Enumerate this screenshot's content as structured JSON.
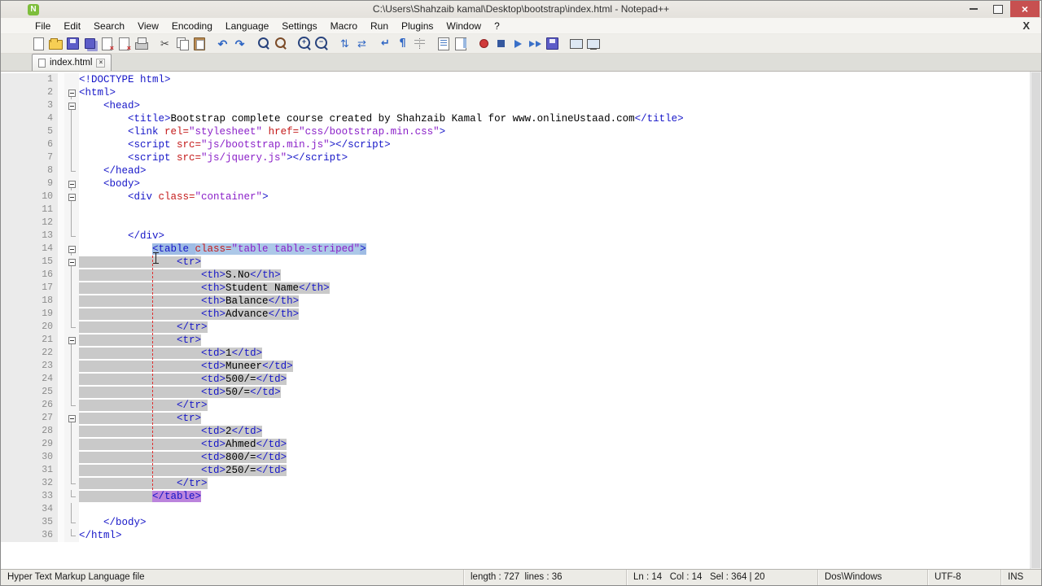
{
  "window": {
    "title": "C:\\Users\\Shahzaib kamal\\Desktop\\bootstrap\\index.html - Notepad++"
  },
  "menu": {
    "items": [
      "File",
      "Edit",
      "Search",
      "View",
      "Encoding",
      "Language",
      "Settings",
      "Macro",
      "Run",
      "Plugins",
      "Window",
      "?"
    ],
    "right_x": "X"
  },
  "toolbar": {
    "icons": [
      "new-file",
      "open-folder",
      "save",
      "save-all",
      "close-doc",
      "close-all",
      "print",
      "|",
      "cut",
      "copy",
      "paste",
      "|",
      "undo",
      "redo",
      "|",
      "find",
      "replace",
      "|",
      "zoom-in",
      "zoom-out",
      "|",
      "sync-v",
      "sync-h",
      "|",
      "word-wrap",
      "show-all-chars",
      "indent-guide",
      "|",
      "function-list",
      "doc-map",
      "|",
      "record-macro",
      "stop-macro",
      "play-macro",
      "run-macro-multi",
      "save-macro",
      "|",
      "fullscreen",
      "doc-monitor"
    ]
  },
  "tabs": [
    {
      "label": "index.html"
    }
  ],
  "editor": {
    "lines": [
      {
        "n": 1,
        "f": "",
        "s": "",
        "g": [
          [
            "doc",
            "<!DOCTYPE html>"
          ]
        ]
      },
      {
        "n": 2,
        "f": "b",
        "s": "",
        "g": [
          [
            "tag",
            "<html>"
          ]
        ]
      },
      {
        "n": 3,
        "f": "b",
        "s": "",
        "g": [
          [
            "w",
            "    "
          ],
          [
            "tag",
            "<head>"
          ]
        ]
      },
      {
        "n": 4,
        "f": "v",
        "s": "",
        "g": [
          [
            "w",
            "        "
          ],
          [
            "tag",
            "<title>"
          ],
          [
            "txt",
            "Bootstrap complete course created by Shahzaib Kamal for www.onlineUstaad.com"
          ],
          [
            "tag",
            "</title>"
          ]
        ]
      },
      {
        "n": 5,
        "f": "v",
        "s": "",
        "g": [
          [
            "w",
            "        "
          ],
          [
            "tag",
            "<link "
          ],
          [
            "attr",
            "rel="
          ],
          [
            "val",
            "\"stylesheet\""
          ],
          [
            "w",
            " "
          ],
          [
            "attr",
            "href="
          ],
          [
            "val",
            "\"css/bootstrap.min.css\""
          ],
          [
            "tag",
            ">"
          ]
        ]
      },
      {
        "n": 6,
        "f": "v",
        "s": "",
        "g": [
          [
            "w",
            "        "
          ],
          [
            "tag",
            "<script "
          ],
          [
            "attr",
            "src="
          ],
          [
            "val",
            "\"js/bootstrap.min.js\""
          ],
          [
            "tag",
            "></script>"
          ]
        ]
      },
      {
        "n": 7,
        "f": "v",
        "s": "",
        "g": [
          [
            "w",
            "        "
          ],
          [
            "tag",
            "<script "
          ],
          [
            "attr",
            "src="
          ],
          [
            "val",
            "\"js/jquery.js\""
          ],
          [
            "tag",
            "></script>"
          ]
        ]
      },
      {
        "n": 8,
        "f": "l",
        "s": "",
        "g": [
          [
            "w",
            "    "
          ],
          [
            "tag",
            "</head>"
          ]
        ]
      },
      {
        "n": 9,
        "f": "b",
        "s": "",
        "g": [
          [
            "w",
            "    "
          ],
          [
            "tag",
            "<body>"
          ]
        ]
      },
      {
        "n": 10,
        "f": "b",
        "s": "",
        "g": [
          [
            "w",
            "        "
          ],
          [
            "tag",
            "<div "
          ],
          [
            "attr",
            "class="
          ],
          [
            "val",
            "\"container\""
          ],
          [
            "tag",
            ">"
          ]
        ]
      },
      {
        "n": 11,
        "f": "v",
        "s": "",
        "g": []
      },
      {
        "n": 12,
        "f": "v",
        "s": "",
        "g": []
      },
      {
        "n": 13,
        "f": "l",
        "s": "",
        "g": [
          [
            "w",
            "        "
          ],
          [
            "tag",
            "</div>"
          ]
        ]
      },
      {
        "n": 14,
        "f": "b",
        "s": "blue",
        "g": [
          [
            "w",
            "            "
          ],
          [
            "tagh",
            "<table "
          ],
          [
            "attr",
            "class="
          ],
          [
            "val",
            "\"table table-striped\""
          ],
          [
            "tagh",
            ">"
          ]
        ]
      },
      {
        "n": 15,
        "f": "b",
        "s": "gray",
        "g": [
          [
            "w",
            "                "
          ],
          [
            "tag",
            "<tr>"
          ]
        ]
      },
      {
        "n": 16,
        "f": "v",
        "s": "gray",
        "g": [
          [
            "w",
            "                    "
          ],
          [
            "tag",
            "<th>"
          ],
          [
            "txt",
            "S.No"
          ],
          [
            "tag",
            "</th>"
          ]
        ]
      },
      {
        "n": 17,
        "f": "v",
        "s": "gray",
        "g": [
          [
            "w",
            "                    "
          ],
          [
            "tag",
            "<th>"
          ],
          [
            "txt",
            "Student Name"
          ],
          [
            "tag",
            "</th>"
          ]
        ]
      },
      {
        "n": 18,
        "f": "v",
        "s": "gray",
        "g": [
          [
            "w",
            "                    "
          ],
          [
            "tag",
            "<th>"
          ],
          [
            "txt",
            "Balance"
          ],
          [
            "tag",
            "</th>"
          ]
        ]
      },
      {
        "n": 19,
        "f": "v",
        "s": "gray",
        "g": [
          [
            "w",
            "                    "
          ],
          [
            "tag",
            "<th>"
          ],
          [
            "txt",
            "Advance"
          ],
          [
            "tag",
            "</th>"
          ]
        ]
      },
      {
        "n": 20,
        "f": "l",
        "s": "gray",
        "g": [
          [
            "w",
            "                "
          ],
          [
            "tag",
            "</tr>"
          ]
        ]
      },
      {
        "n": 21,
        "f": "b",
        "s": "gray",
        "g": [
          [
            "w",
            "                "
          ],
          [
            "tag",
            "<tr>"
          ]
        ]
      },
      {
        "n": 22,
        "f": "v",
        "s": "gray",
        "g": [
          [
            "w",
            "                    "
          ],
          [
            "tag",
            "<td>"
          ],
          [
            "txt",
            "1"
          ],
          [
            "tag",
            "</td>"
          ]
        ]
      },
      {
        "n": 23,
        "f": "v",
        "s": "gray",
        "g": [
          [
            "w",
            "                    "
          ],
          [
            "tag",
            "<td>"
          ],
          [
            "txt",
            "Muneer"
          ],
          [
            "tag",
            "</td>"
          ]
        ]
      },
      {
        "n": 24,
        "f": "v",
        "s": "gray",
        "g": [
          [
            "w",
            "                    "
          ],
          [
            "tag",
            "<td>"
          ],
          [
            "txt",
            "500/="
          ],
          [
            "tag",
            "</td>"
          ]
        ]
      },
      {
        "n": 25,
        "f": "v",
        "s": "gray",
        "g": [
          [
            "w",
            "                    "
          ],
          [
            "tag",
            "<td>"
          ],
          [
            "txt",
            "50/="
          ],
          [
            "tag",
            "</td>"
          ]
        ]
      },
      {
        "n": 26,
        "f": "l",
        "s": "gray",
        "g": [
          [
            "w",
            "                "
          ],
          [
            "tag",
            "</tr>"
          ]
        ]
      },
      {
        "n": 27,
        "f": "b",
        "s": "gray",
        "g": [
          [
            "w",
            "                "
          ],
          [
            "tag",
            "<tr>"
          ]
        ]
      },
      {
        "n": 28,
        "f": "v",
        "s": "gray",
        "g": [
          [
            "w",
            "                    "
          ],
          [
            "tag",
            "<td>"
          ],
          [
            "txt",
            "2"
          ],
          [
            "tag",
            "</td>"
          ]
        ]
      },
      {
        "n": 29,
        "f": "v",
        "s": "gray",
        "g": [
          [
            "w",
            "                    "
          ],
          [
            "tag",
            "<td>"
          ],
          [
            "txt",
            "Ahmed"
          ],
          [
            "tag",
            "</td>"
          ]
        ]
      },
      {
        "n": 30,
        "f": "v",
        "s": "gray",
        "g": [
          [
            "w",
            "                    "
          ],
          [
            "tag",
            "<td>"
          ],
          [
            "txt",
            "800/="
          ],
          [
            "tag",
            "</td>"
          ]
        ]
      },
      {
        "n": 31,
        "f": "v",
        "s": "gray",
        "g": [
          [
            "w",
            "                    "
          ],
          [
            "tag",
            "<td>"
          ],
          [
            "txt",
            "250/="
          ],
          [
            "tag",
            "</td>"
          ]
        ]
      },
      {
        "n": 32,
        "f": "l",
        "s": "gray",
        "g": [
          [
            "w",
            "                "
          ],
          [
            "tag",
            "</tr>"
          ]
        ]
      },
      {
        "n": 33,
        "f": "l",
        "s": "gray",
        "g": [
          [
            "w",
            "            "
          ],
          [
            "tagm",
            "</table>"
          ]
        ]
      },
      {
        "n": 34,
        "f": "v",
        "s": "",
        "g": []
      },
      {
        "n": 35,
        "f": "l",
        "s": "",
        "g": [
          [
            "w",
            "    "
          ],
          [
            "tag",
            "</body>"
          ]
        ]
      },
      {
        "n": 36,
        "f": "l",
        "s": "",
        "g": [
          [
            "tag",
            "</html>"
          ]
        ]
      }
    ]
  },
  "statusbar": {
    "doctype": "Hyper Text Markup Language file",
    "length_info": "length : 727  lines : 36",
    "position_info": "Ln : 14   Col : 14   Sel : 364 | 20",
    "eol": "Dos\\Windows",
    "encoding": "UTF-8",
    "mode": "INS"
  }
}
